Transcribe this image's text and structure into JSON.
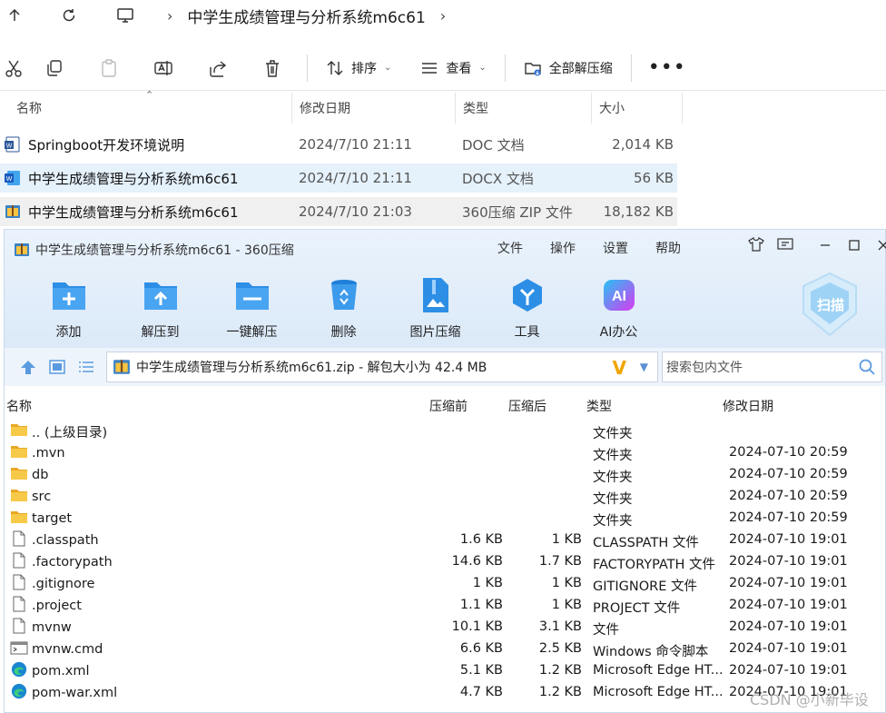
{
  "explorer": {
    "breadcrumb": [
      "中学生成绩管理与分析系统m6c61"
    ],
    "toolbar": {
      "sort_label": "排序",
      "view_label": "查看",
      "extract_all_label": "全部解压缩"
    },
    "columns": [
      "名称",
      "修改日期",
      "类型",
      "大小"
    ],
    "rows": [
      {
        "name": "Springboot开发环境说明",
        "date": "2024/7/10 21:11",
        "type": "DOC 文档",
        "size": "2,014 KB",
        "icon": "word-doc-icon"
      },
      {
        "name": "中学生成绩管理与分析系统m6c61",
        "date": "2024/7/10 21:11",
        "type": "DOCX 文档",
        "size": "56 KB",
        "icon": "word-docx-icon"
      },
      {
        "name": "中学生成绩管理与分析系统m6c61",
        "date": "2024/7/10 21:03",
        "type": "360压缩 ZIP 文件",
        "size": "18,182 KB",
        "icon": "zip-archive-icon"
      }
    ],
    "colors": {
      "selected_row": "#e5f1fb",
      "hover_row": "#f0f0f0"
    }
  },
  "zipwin": {
    "title": "中学生成绩管理与分析系统m6c61 - 360压缩",
    "menu": [
      "文件",
      "操作",
      "设置",
      "帮助"
    ],
    "tools": [
      {
        "label": "添加",
        "icon": "add-folder-icon"
      },
      {
        "label": "解压到",
        "icon": "extract-to-icon"
      },
      {
        "label": "一键解压",
        "icon": "one-click-extract-icon"
      },
      {
        "label": "删除",
        "icon": "recycle-bin-icon"
      },
      {
        "label": "图片压缩",
        "icon": "image-compress-icon"
      },
      {
        "label": "工具",
        "icon": "tools-icon"
      },
      {
        "label": "AI办公",
        "icon": "ai-office-icon"
      }
    ],
    "scan_label": "扫描",
    "address": "中学生成绩管理与分析系统m6c61.zip - 解包大小为 42.4 MB",
    "search_placeholder": "搜索包内文件",
    "columns": {
      "name": "名称",
      "before": "压缩前",
      "after": "压缩后",
      "type": "类型",
      "date": "修改日期"
    },
    "files": [
      {
        "name": ".. (上级目录)",
        "before": "",
        "after": "",
        "type": "文件夹",
        "date": "",
        "icon": "folder-icon"
      },
      {
        "name": ".mvn",
        "before": "",
        "after": "",
        "type": "文件夹",
        "date": "2024-07-10 20:59",
        "icon": "folder-icon"
      },
      {
        "name": "db",
        "before": "",
        "after": "",
        "type": "文件夹",
        "date": "2024-07-10 20:59",
        "icon": "folder-icon"
      },
      {
        "name": "src",
        "before": "",
        "after": "",
        "type": "文件夹",
        "date": "2024-07-10 20:59",
        "icon": "folder-icon"
      },
      {
        "name": "target",
        "before": "",
        "after": "",
        "type": "文件夹",
        "date": "2024-07-10 20:59",
        "icon": "folder-icon"
      },
      {
        "name": ".classpath",
        "before": "1.6 KB",
        "after": "1 KB",
        "type": "CLASSPATH 文件",
        "date": "2024-07-10 19:01",
        "icon": "file-icon"
      },
      {
        "name": ".factorypath",
        "before": "14.6 KB",
        "after": "1.7 KB",
        "type": "FACTORYPATH 文件",
        "date": "2024-07-10 19:01",
        "icon": "file-icon"
      },
      {
        "name": ".gitignore",
        "before": "1 KB",
        "after": "1 KB",
        "type": "GITIGNORE 文件",
        "date": "2024-07-10 19:01",
        "icon": "file-icon"
      },
      {
        "name": ".project",
        "before": "1.1 KB",
        "after": "1 KB",
        "type": "PROJECT 文件",
        "date": "2024-07-10 19:01",
        "icon": "file-icon"
      },
      {
        "name": "mvnw",
        "before": "10.1 KB",
        "after": "3.1 KB",
        "type": "文件",
        "date": "2024-07-10 19:01",
        "icon": "file-icon"
      },
      {
        "name": "mvnw.cmd",
        "before": "6.6 KB",
        "after": "2.5 KB",
        "type": "Windows 命令脚本",
        "date": "2024-07-10 19:01",
        "icon": "cmd-script-icon"
      },
      {
        "name": "pom.xml",
        "before": "5.1 KB",
        "after": "1.2 KB",
        "type": "Microsoft Edge HT...",
        "date": "2024-07-10 19:01",
        "icon": "edge-icon"
      },
      {
        "name": "pom-war.xml",
        "before": "4.7 KB",
        "after": "1.2 KB",
        "type": "Microsoft Edge HT...",
        "date": "2024-07-10 19:01",
        "icon": "edge-icon"
      }
    ]
  },
  "watermark": "CSDN @小新毕设"
}
